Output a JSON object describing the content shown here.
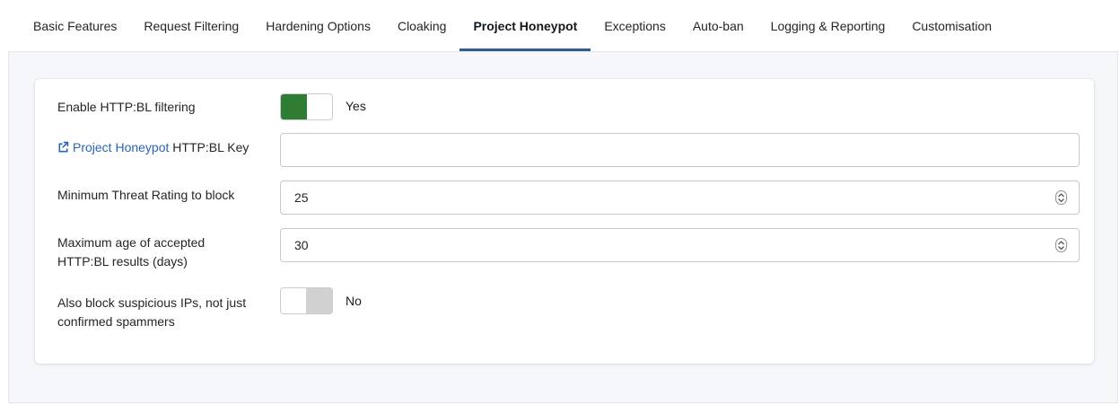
{
  "tabs": [
    {
      "label": "Basic Features"
    },
    {
      "label": "Request Filtering"
    },
    {
      "label": "Hardening Options"
    },
    {
      "label": "Cloaking"
    },
    {
      "label": "Project Honeypot"
    },
    {
      "label": "Exceptions"
    },
    {
      "label": "Auto-ban"
    },
    {
      "label": "Logging & Reporting"
    },
    {
      "label": "Customisation"
    }
  ],
  "active_tab": "Project Honeypot",
  "form": {
    "enable_filtering": {
      "label": "Enable HTTP:BL filtering",
      "state_text": "Yes",
      "checked": true
    },
    "api_key": {
      "link_text": "Project Honeypot",
      "label_rest": " HTTP:BL Key",
      "value": ""
    },
    "min_threat": {
      "label": "Minimum Threat Rating to block",
      "value": "25"
    },
    "max_age": {
      "label_line1": "Maximum age of accepted",
      "label_line2": "HTTP:BL results (days)",
      "value": "30"
    },
    "block_suspicious": {
      "label_line1": "Also block suspicious IPs, not just",
      "label_line2": "confirmed spammers",
      "state_text": "No",
      "checked": false
    }
  },
  "colors": {
    "toggle_on": "#2f7d32",
    "toggle_off": "#d1d1d1",
    "link": "#2a64b5",
    "tab_underline": "#2f5d91"
  }
}
